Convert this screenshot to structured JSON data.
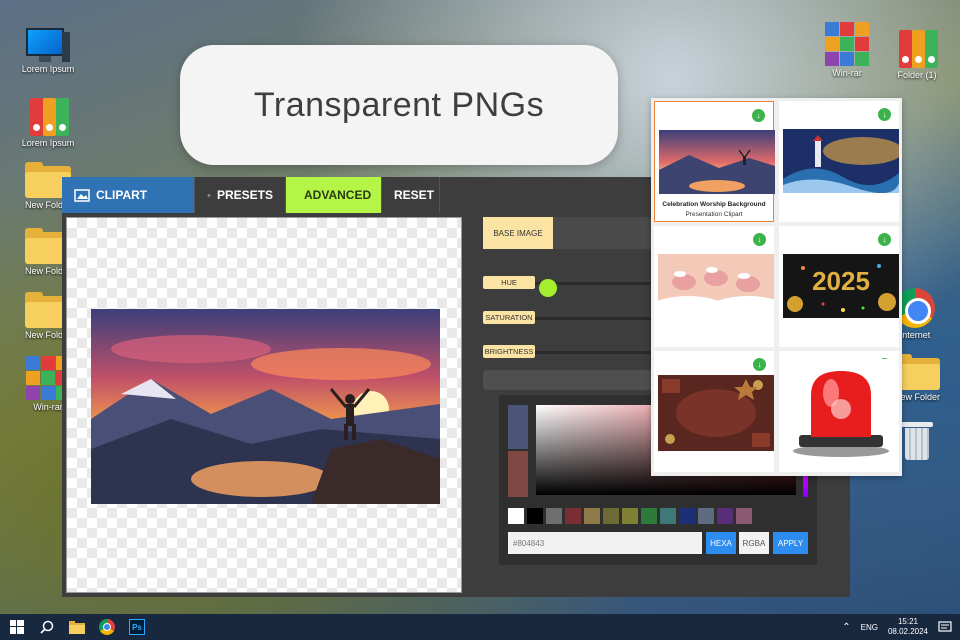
{
  "bubble": {
    "title": "Transparent PNGs"
  },
  "desktop": {
    "left_icons": [
      {
        "label": "Lorem Ipsum",
        "icon": "computer-icon"
      },
      {
        "label": "Lorem Ipsum",
        "icon": "binders-icon"
      },
      {
        "label": "New Folder",
        "icon": "folder-icon"
      },
      {
        "label": "New Folder",
        "icon": "folder-icon"
      },
      {
        "label": "New Folder",
        "icon": "folder-icon"
      },
      {
        "label": "Win-rar",
        "icon": "winrar-icon"
      }
    ],
    "right_icons": [
      {
        "label": "Win-rar",
        "icon": "winrar-icon"
      },
      {
        "label": "Folder (1)",
        "icon": "binders-icon"
      },
      {
        "label": "Internet",
        "icon": "chrome-icon"
      },
      {
        "label": "New Folder",
        "icon": "folder-icon"
      },
      {
        "label": "",
        "icon": "recycle-bin-icon"
      }
    ]
  },
  "editor": {
    "toolbar": {
      "clipart": "CLIPART",
      "presets": "PRESETS",
      "advanced": "ADVANCED",
      "reset": "RESET"
    },
    "tab_base": "BASE IMAGE",
    "sliders": {
      "hue": "HUE",
      "saturation": "SATURATION",
      "brightness": "BRIGHTNESS"
    },
    "picker": {
      "hex_value": "#804843",
      "hexa": "HEXA",
      "rgba": "RGBA",
      "apply": "APPLY",
      "swatches": [
        "#ffffff",
        "#000000",
        "#6e6e6e",
        "#7a2d35",
        "#8f7a4a",
        "#6d6a36",
        "#7f8033",
        "#2d7a3a",
        "#3f7878",
        "#1e2f7a",
        "#5e6b80",
        "#5a2d7a",
        "#8a5a73"
      ],
      "current_top": "#4b5575",
      "current_bottom": "#804843"
    }
  },
  "gallery": {
    "items": [
      {
        "title": "Celebration Worship Background",
        "subtitle": "Presentation Clipart",
        "image": "sunset-mountain-person"
      },
      {
        "title": "",
        "subtitle": "",
        "image": "lighthouse-waves"
      },
      {
        "title": "",
        "subtitle": "",
        "image": "flying-pigs-clouds"
      },
      {
        "title": "",
        "subtitle": "",
        "image": "2025-fireworks"
      },
      {
        "title": "",
        "subtitle": "",
        "image": "christmas-frame"
      },
      {
        "title": "",
        "subtitle": "",
        "image": "red-siren"
      }
    ],
    "year_text": "2025"
  },
  "taskbar": {
    "language": "ENG",
    "time": "15:21",
    "date": "08.02.2024",
    "ps_label": "Ps"
  }
}
